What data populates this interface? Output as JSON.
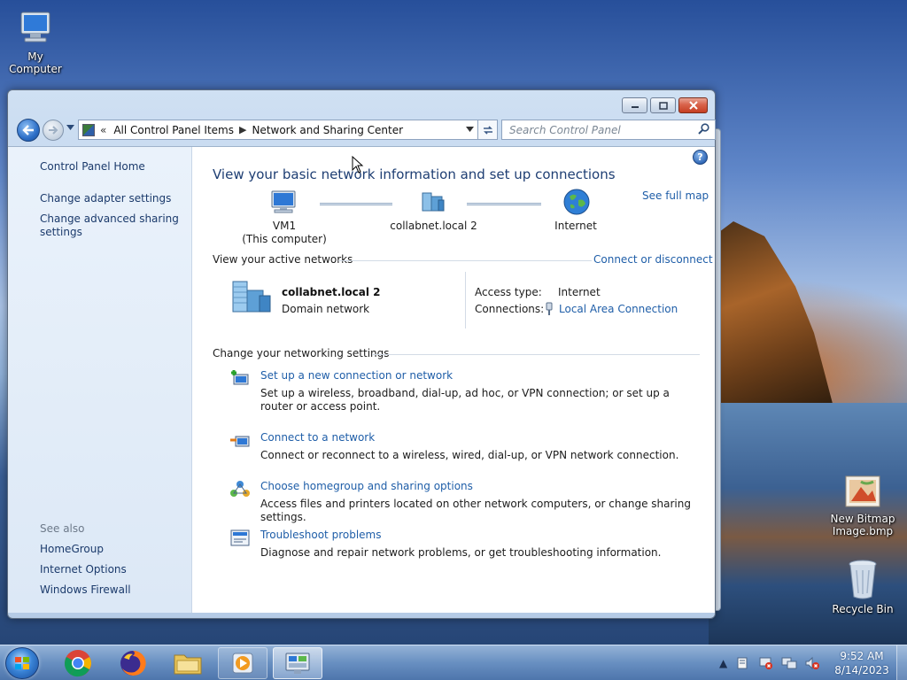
{
  "desktop": {
    "icons": [
      {
        "label": "My Computer"
      },
      {
        "label": "New Bitmap Image.bmp"
      },
      {
        "label": "Recycle Bin"
      }
    ]
  },
  "window": {
    "address": {
      "overflow": "«",
      "crumbs": [
        "All Control Panel Items",
        "Network and Sharing Center"
      ]
    },
    "search_placeholder": "Search Control Panel",
    "left_pane": {
      "home": "Control Panel Home",
      "links": [
        "Change adapter settings",
        "Change advanced sharing settings"
      ],
      "see_also_label": "See also",
      "see_also": [
        "HomeGroup",
        "Internet Options",
        "Windows Firewall"
      ]
    },
    "main": {
      "heading": "View your basic network information and set up connections",
      "see_full_map": "See full map",
      "map": {
        "computer_name": "VM1",
        "computer_sub": "(This computer)",
        "network": "collabnet.local  2",
        "internet": "Internet"
      },
      "active_networks": {
        "title": "View your active networks",
        "connect_link": "Connect or disconnect",
        "network_name": "collabnet.local  2",
        "network_type": "Domain network",
        "access_type_label": "Access type:",
        "access_type_value": "Internet",
        "connections_label": "Connections:",
        "connections_value": "Local Area Connection"
      },
      "settings": {
        "title": "Change your networking settings",
        "tasks": [
          {
            "title": "Set up a new connection or network",
            "desc": "Set up a wireless, broadband, dial-up, ad hoc, or VPN connection; or set up a router or access point."
          },
          {
            "title": "Connect to a network",
            "desc": "Connect or reconnect to a wireless, wired, dial-up, or VPN network connection."
          },
          {
            "title": "Choose homegroup and sharing options",
            "desc": "Access files and printers located on other network computers, or change sharing settings."
          },
          {
            "title": "Troubleshoot problems",
            "desc": "Diagnose and repair network problems, or get troubleshooting information."
          }
        ]
      }
    }
  },
  "taskbar": {
    "pinned": [
      "chrome-icon",
      "firefox-icon",
      "file-explorer-icon",
      "media-player-icon",
      "control-panel-icon"
    ],
    "clock_time": "9:52 AM",
    "clock_date": "8/14/2023"
  }
}
